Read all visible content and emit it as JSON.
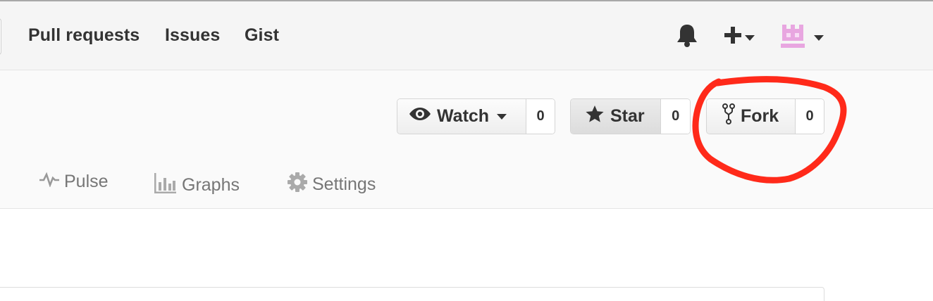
{
  "header": {
    "nav": [
      "Pull requests",
      "Issues",
      "Gist"
    ],
    "icons": [
      "bell-icon",
      "plus-icon",
      "chevron-down-icon",
      "avatar",
      "chevron-down-icon"
    ]
  },
  "actions": {
    "watch": {
      "label": "Watch",
      "count": "0",
      "icon": "eye-icon"
    },
    "star": {
      "label": "Star",
      "count": "0",
      "icon": "star-icon"
    },
    "fork": {
      "label": "Fork",
      "count": "0",
      "icon": "repo-forked-icon"
    }
  },
  "tabs": [
    {
      "label": "Pulse",
      "icon": "pulse-icon"
    },
    {
      "label": "Graphs",
      "icon": "graph-icon"
    },
    {
      "label": "Settings",
      "icon": "gear-icon"
    }
  ],
  "colors": {
    "annotation": "#ff2a1a",
    "avatar": "#e8a6e0",
    "tab_text": "#767676",
    "header_bg": "#f5f5f5"
  }
}
